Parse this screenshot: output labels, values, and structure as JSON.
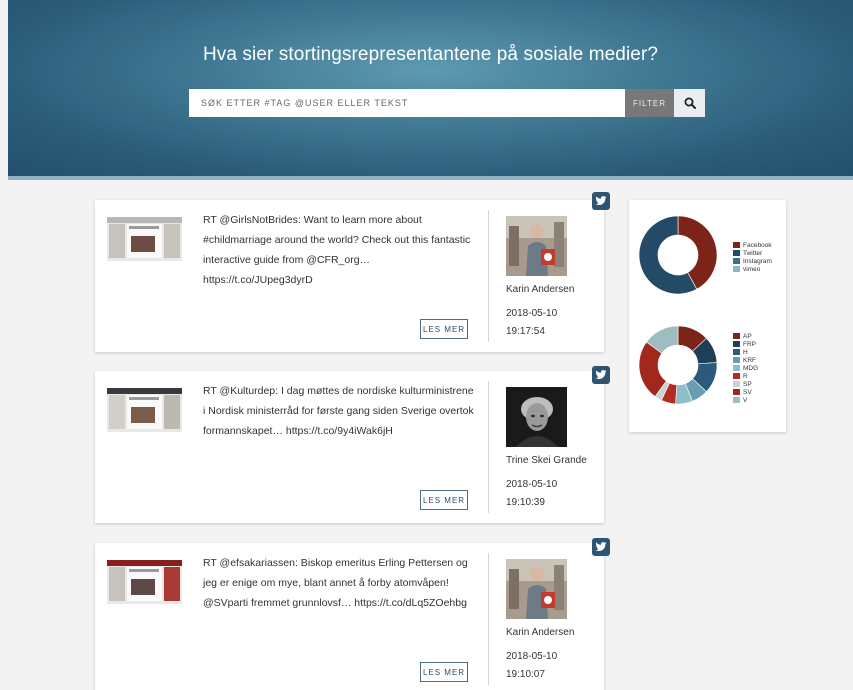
{
  "header": {
    "title": "Hva sier stortingsrepresentantene på sosiale medier?",
    "search_placeholder": "SØK ETTER #TAG @USER ELLER TEKST",
    "filter_label": "FILTER"
  },
  "posts": [
    {
      "text": "RT @GirlsNotBrides: Want to learn more about #childmarriage around the world? Check out this fantastic interactive guide from @CFR_org… https://t.co/JUpeg3dyrD",
      "author": "Karin Andersen",
      "date": "2018-05-10",
      "time": "19:17:54",
      "more_label": "LES MER",
      "source": "twitter"
    },
    {
      "text": "RT @Kulturdep: I dag møttes de nordiske kulturministrene i Nordisk ministerråd for første gang siden Sverige overtok formannskapet… https://t.co/9y4iWak6jH",
      "author": "Trine Skei Grande",
      "date": "2018-05-10",
      "time": "19:10:39",
      "more_label": "LES MER",
      "source": "twitter"
    },
    {
      "text": "RT @efsakariassen: Biskop emeritus Erling Pettersen og jeg er enige om mye, blant annet å forby atomvåpen! @SVparti fremmet grunnlovsf… https://t.co/dLq5ZOehbg",
      "author": "Karin Andersen",
      "date": "2018-05-10",
      "time": "19:10:07",
      "more_label": "LES MER",
      "source": "twitter"
    }
  ],
  "chart_data": [
    {
      "type": "pie",
      "categories": [
        "Facebook",
        "Twitter",
        "Instagram",
        "vimeo"
      ],
      "values": [
        42,
        58,
        0,
        0
      ],
      "colors": [
        "#7d2418",
        "#234b68",
        "#3b6f8c",
        "#8ab7c4"
      ],
      "legend": "right"
    },
    {
      "type": "pie",
      "categories": [
        "AP",
        "FRP",
        "H",
        "KRF",
        "MDG",
        "R",
        "SP",
        "SV",
        "V"
      ],
      "values": [
        13,
        11,
        13,
        7,
        7,
        6,
        3,
        25,
        15
      ],
      "colors": [
        "#7d2418",
        "#1f3f58",
        "#2c5a7a",
        "#6b9db2",
        "#8dbec9",
        "#b42b24",
        "#c7d3d6",
        "#a1281d",
        "#9fbcc1"
      ],
      "legend": "right"
    }
  ]
}
